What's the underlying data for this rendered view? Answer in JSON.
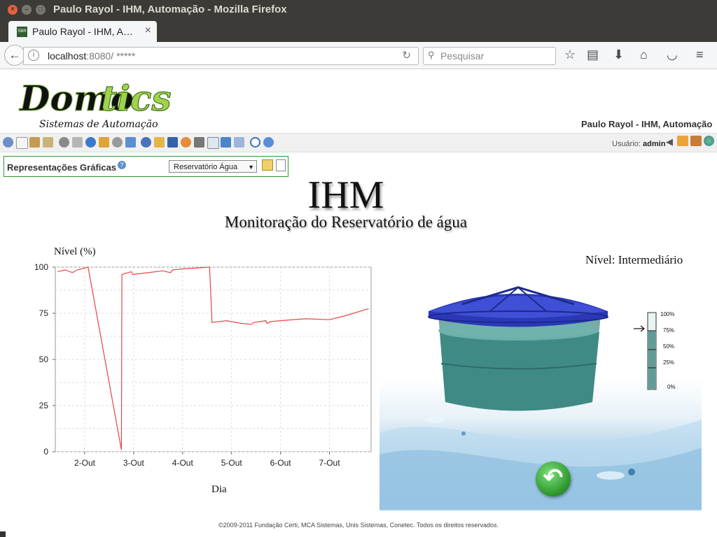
{
  "window": {
    "title": "Paulo Rayol - IHM, Automação - Mozilla Firefox"
  },
  "tab": {
    "label": "Paulo Rayol - IHM, A…",
    "favicon_text": "SBR"
  },
  "addressbar": {
    "host": "localhost",
    "rest": ":8080/ *****"
  },
  "search": {
    "placeholder": "Pesquisar"
  },
  "app": {
    "logo_main": "Domo",
    "logo_accent": "tics",
    "logo_tagline": "Sistemas de Automação",
    "header_user": "Paulo Rayol - IHM, Automação",
    "user_label": "Usuário:",
    "user_name": "admin"
  },
  "rep": {
    "title": "Representações Gráficas",
    "selected": "Reservatório Água"
  },
  "page": {
    "title": "IHM",
    "subtitle": "Monitoração do Reservatório de água"
  },
  "chart_data": {
    "type": "line",
    "title": "",
    "ylabel": "Nível (%)",
    "xlabel": "Dia",
    "ylim": [
      0,
      100
    ],
    "yticks": [
      "0",
      "25",
      "50",
      "75",
      "100"
    ],
    "xticks": [
      "2-Out",
      "3-Out",
      "4-Out",
      "5-Out",
      "6-Out",
      "7-Out"
    ],
    "xlim": [
      1.4,
      7.85
    ],
    "grid": true,
    "series_color": "#e84545",
    "x": [
      1.45,
      1.6,
      1.75,
      1.85,
      2.0,
      2.07,
      2.75,
      2.76,
      2.95,
      2.98,
      3.3,
      3.6,
      3.75,
      3.8,
      4.0,
      4.55,
      4.6,
      4.9,
      5.2,
      5.4,
      5.45,
      5.7,
      5.72,
      5.8,
      6.0,
      6.5,
      7.0,
      7.3,
      7.8
    ],
    "y": [
      97.5,
      98.5,
      97,
      98.5,
      99.5,
      100,
      1,
      96,
      97.5,
      96,
      97,
      98,
      97,
      98.5,
      99,
      100,
      70,
      71,
      69.5,
      69,
      70,
      71,
      69.5,
      70.5,
      71,
      72,
      71.5,
      73.5,
      77.5
    ]
  },
  "tank": {
    "nivel_label": "Nível:",
    "nivel_value": "Intermediário",
    "level_percent": 75,
    "gauge_labels": [
      "100%",
      "75%",
      "50%",
      "25%",
      "0%"
    ]
  },
  "footer": {
    "text": "©2009-2011 Fundação Certi, MCA Sistemas, Unis Sistemas, Conetec. Todos os direitos reservados."
  },
  "icons": {
    "nav": [
      "back-icon",
      "info-icon",
      "reload-icon",
      "search-icon",
      "bookmark-star-icon",
      "reading-list-icon",
      "download-icon",
      "home-icon",
      "pocket-icon",
      "menu-icon"
    ],
    "app_right": [
      "sound-icon",
      "home-icon",
      "home-settings-icon",
      "globe-icon"
    ]
  },
  "colors": {
    "accent_green": "#2e9a2e",
    "tank_lid": "#2a38b8",
    "tank_water": "#4d9a94",
    "titlebar": "#3c3b37"
  }
}
